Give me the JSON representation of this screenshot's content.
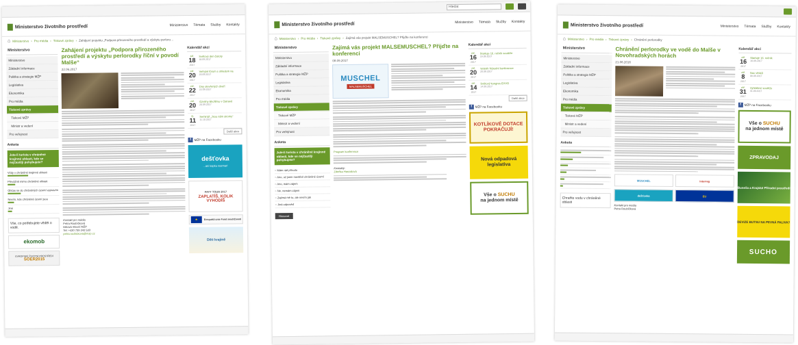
{
  "site": {
    "title": "Ministerstvo životního prostředí",
    "nav": [
      "Ministerstvo",
      "Témata",
      "Služby",
      "Kontakty"
    ],
    "search_placeholder": "Hledat"
  },
  "sidebar": {
    "heading": "Ministerstvo",
    "items": [
      "Ministerstvo",
      "Základní informace",
      "Politika a strategie MŽP",
      "Legislativa",
      "Ekonomika",
      "Pro média",
      "Tiskové zprávy",
      "Tiskové MŽP",
      "Ministr a vedení",
      "Pro veřejnost"
    ]
  },
  "page1": {
    "breadcrumb": [
      "Ministerstvo",
      "Pro média",
      "Tiskové zprávy",
      "Zahájení projektu „Podpora přirozeného prostředí a výskytu perlorodky říční v povodí Malše“"
    ],
    "title": "Zahájení projektu „Podpora přirozeného prostředí a výskytu perlorodky říční v povodí Malše“",
    "date": "22.06.2017",
    "calendar_heading": "Kalendář akcí",
    "events": [
      {
        "month": "zář.",
        "day": "18",
        "year": "2017",
        "title": "Světový den čistoty",
        "time": "18.09.2017"
      },
      {
        "month": "zář.",
        "day": "20",
        "year": "2017",
        "title": "Veřejné fórum s ohledem na",
        "time": "20.09.2017"
      },
      {
        "month": "zář.",
        "day": "22",
        "year": "2017",
        "title": "Dny otevřených dveří",
        "time": "22.09.2017"
      },
      {
        "month": "zář.",
        "day": "20",
        "year": "2017",
        "title": "Ozvěny Ekofilmu v Ostravě",
        "time": "20.09.2017"
      },
      {
        "month": "říj.",
        "day": "11",
        "year": "2017",
        "title": "Seminář „Jsou nám stromy“",
        "time": "11.10.2017"
      }
    ],
    "calendar_all": "Další akce",
    "facebook": "MŽP na Facebooku",
    "poll_heading": "Anketa",
    "poll_question": "Jste-li turista v chráněné krajinné oblasti, kde se nejčastěji pohybujete?",
    "poll_options": [
      "Vždy v chráněné krajinné oblasti",
      "Převážně mimo chráněné oblasti",
      "Občas se do chráněných území vypravím",
      "Nevím, kde chráněná území jsou",
      "Jiné"
    ],
    "slogan": "Vše, co potřebujete vědět o vodě.",
    "ekomob": "ekomob",
    "soer_caption": "EVROPSKÉ ŽIVOTNÍ PROSTŘEDÍ",
    "soer": "SOER2015",
    "contact_label": "Kontakt pro média",
    "contact_name": "Petra Roubíčková",
    "contact_org": "tisková mluvčí MŽP",
    "contact_tel": "Tel: +420 739 242 533",
    "contact_email": "petra.roubickova@mzp.cz",
    "banner_destovka": "dešťovka",
    "banner_destovka_sub": "...ani kapku nazmar!",
    "banner_kolik": "PAYT TOUR 2017",
    "banner_kolik_main": "ZAPLATÍŠ, KOLIK VYHODÍŠ",
    "banner_kids": "Děti krajině",
    "eu_text": "Evropská unie Fond soudržnosti"
  },
  "page2": {
    "breadcrumb": [
      "Ministerstvo",
      "Pro média",
      "Tiskové zprávy",
      "Zajímá vás projekt MALSEMUSCHEL? Přijďte na konferenci"
    ],
    "title": "Zajímá vás projekt MALSEMUSCHEL? Přijďte na konferenci",
    "date": "08.09.2017",
    "muschel_logo": "MUSCHEL",
    "muschel_tag": "MALSEMUSCHEL",
    "calendar_heading": "Kalendář akcí",
    "events": [
      {
        "month": "zář.",
        "day": "16",
        "year": "2017",
        "title": "Startuje 16. ročník soutěže",
        "time": "16.09.2017"
      },
      {
        "month": "zář.",
        "day": "20",
        "year": "2017",
        "title": "Veletrh Národní konference",
        "time": "20.09.2017"
      },
      {
        "month": "zář.",
        "day": "14",
        "year": "2017",
        "title": "Světový kongres EVVO",
        "time": "14.09.2017"
      }
    ],
    "calendar_all": "Další akce",
    "facebook": "MŽP na Facebooku",
    "poll_heading": "Anketa",
    "poll_question": "Jste-li turista v chráněné krajinné oblasti, kde se nejčastěji pohybujete?",
    "poll_options": [
      "Mám rád přírodu",
      "Ano, už jsem navštívil chráněné území",
      "Ano, mám zájem",
      "Ne, nemám zájem",
      "Zajímá mě to, ale nevím jak",
      "Jiná odpověď"
    ],
    "vote": "Hlasovat",
    "program_label": "Program konference",
    "contact_label": "Kontakty:",
    "contact_name": "Zdeňka Hanzalová",
    "banner_kotlik": "KOTLÍKOVÉ DOTACE POKRAČUJÍ!",
    "banner_legis": "Nová odpadová legislativa",
    "banner_sucho_a": "Vše o",
    "banner_sucho_b": "SUCHU",
    "banner_sucho_c": "na jednom místě"
  },
  "page3": {
    "breadcrumb": [
      "Ministerstvo",
      "Pro média",
      "Tiskové zprávy",
      "Chránění perlorodky"
    ],
    "title": "Chránění perlorodky ve vodě do Malše v Novohradských horách",
    "date": "21.06.2016",
    "calendar_heading": "Kalendář akcí",
    "events": [
      {
        "month": "zář.",
        "day": "16",
        "year": "2017",
        "title": "Startuje 16. ročník",
        "time": "16.09.2017"
      },
      {
        "month": "zář.",
        "day": "8",
        "year": "2017",
        "title": "Noc vědců",
        "time": "08.09.2017"
      },
      {
        "month": "zář.",
        "day": "31",
        "year": "2017",
        "title": "Vyhlášení soutěže",
        "time": "31.09.2017"
      }
    ],
    "facebook": "MŽP na Facebooku",
    "poll_heading": "Anketa",
    "banner_sucho_a": "Vše o",
    "banner_sucho_b": "SUCHU",
    "banner_sucho_c": "na jednom místě",
    "banner_zpravodaj": "ZPRAVODAJ",
    "banner_prales": "Buneša a Krajské Přírodní prostředí",
    "banner_kamna": "DEVIZE BUTSU NA PEVNÁ PALIVA?",
    "banner_sucho3": "SUCHO",
    "slogan": "Chraňte vodu v chráněné oblasti",
    "logo_muschel": "MUSCHEL",
    "logo_interreg": "interreg",
    "logo_destovka": "dešťovka",
    "logo_eu": "EU",
    "contact_label": "Kontakt pro média",
    "contact_name": "Petra Roubíčková"
  }
}
